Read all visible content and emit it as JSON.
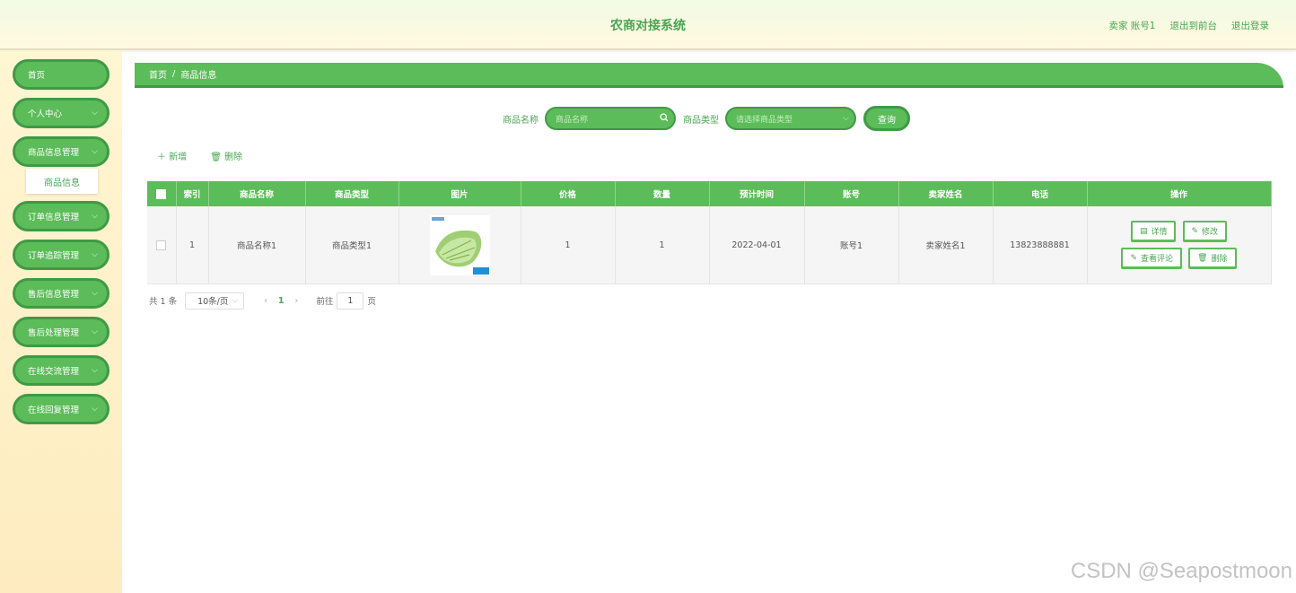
{
  "header": {
    "title": "农商对接系统",
    "user": "卖家 账号1",
    "back_front": "退出到前台",
    "logout": "退出登录"
  },
  "sidebar": {
    "items": [
      {
        "label": "首页",
        "has_arrow": false
      },
      {
        "label": "个人中心",
        "has_arrow": true
      },
      {
        "label": "商品信息管理",
        "has_arrow": true
      },
      {
        "label": "订单信息管理",
        "has_arrow": true
      },
      {
        "label": "订单追踪管理",
        "has_arrow": true
      },
      {
        "label": "售后信息管理",
        "has_arrow": true
      },
      {
        "label": "售后处理管理",
        "has_arrow": true
      },
      {
        "label": "在线交流管理",
        "has_arrow": true
      },
      {
        "label": "在线回复管理",
        "has_arrow": true
      }
    ],
    "submenu": {
      "label": "商品信息"
    }
  },
  "breadcrumb": {
    "home": "首页",
    "separator": "/",
    "current": "商品信息"
  },
  "search": {
    "name_label": "商品名称",
    "name_placeholder": "商品名称",
    "type_label": "商品类型",
    "type_placeholder": "请选择商品类型",
    "query_button": "查询"
  },
  "toolbar": {
    "add": "＋ 新增",
    "delete": "删除"
  },
  "table": {
    "headers": [
      "索引",
      "商品名称",
      "商品类型",
      "图片",
      "价格",
      "数量",
      "预计时间",
      "账号",
      "卖家姓名",
      "电话",
      "操作"
    ],
    "rows": [
      {
        "index": "1",
        "name": "商品名称1",
        "type": "商品类型1",
        "price": "1",
        "quantity": "1",
        "date": "2022-04-01",
        "account": "账号1",
        "seller": "卖家姓名1",
        "phone": "13823888881"
      }
    ],
    "actions": {
      "detail": "详情",
      "edit": "修改",
      "comments": "查看评论",
      "delete": "删除"
    }
  },
  "pagination": {
    "total": "共 1 条",
    "page_size": "10条/页",
    "current_page": "1",
    "goto_prefix": "前往",
    "goto_value": "1",
    "goto_suffix": "页"
  },
  "watermark": "CSDN @Seapostmoon",
  "colors": {
    "accent": "#5cbc59",
    "accent_dark": "#3f9a45",
    "text_green": "#4aa553"
  }
}
